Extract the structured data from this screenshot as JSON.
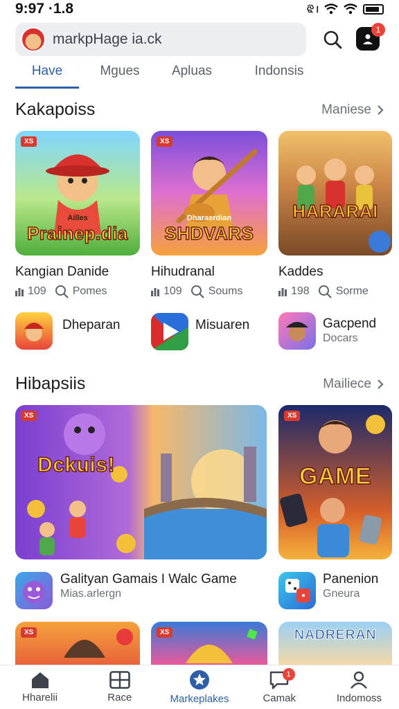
{
  "status": {
    "time": "9:97 ·1.8",
    "signal_text": "ଝି।"
  },
  "search": {
    "text": "markpHage ia.ck"
  },
  "header": {
    "notification_count": "1"
  },
  "tabs": [
    {
      "label": "Have"
    },
    {
      "label": "Mgues"
    },
    {
      "label": "Apluas"
    },
    {
      "label": "Indonsis"
    }
  ],
  "section1": {
    "title": "Kakapoiss",
    "more": "Maniese",
    "cards": [
      {
        "tag": "XS",
        "art_title": "Prainep.dia",
        "art_sub": "Ailles",
        "name": "Kangian Danide",
        "count": "109",
        "meta": "Pomes"
      },
      {
        "tag": "XS",
        "art_title": "SHDVARS",
        "art_sub": "Dharaerdian",
        "name": "Hihudranal",
        "count": "109",
        "meta": "Soums"
      },
      {
        "tag": "",
        "art_title": "HARARAI",
        "art_sub": "",
        "name": "Kaddes",
        "count": "198",
        "meta": "Sorme"
      }
    ],
    "rows": [
      {
        "title": "Dheparan",
        "sub": ""
      },
      {
        "title": "Misuaren",
        "sub": ""
      },
      {
        "title": "Gacpend",
        "sub": "Docars"
      }
    ]
  },
  "section2": {
    "title": "Hibapsiis",
    "more": "Mailiece",
    "cards": [
      {
        "tag": "XS",
        "art_title": "Dckuis!"
      },
      {
        "tag": "XS",
        "art_title": "GAME"
      }
    ],
    "rows": [
      {
        "title": "Galityan Gamais I Walc Game",
        "sub": "Mias.arlergn"
      },
      {
        "title": "Panenion",
        "sub": "Gneura"
      }
    ],
    "peek_cards": [
      {
        "tag": "XS",
        "art_title": ""
      },
      {
        "tag": "XS",
        "art_title": ""
      },
      {
        "tag": "",
        "art_title": "NADRERAN"
      }
    ]
  },
  "nav": [
    {
      "label": "Hharelii",
      "icon": "home-icon"
    },
    {
      "label": "Race",
      "icon": "grid-icon"
    },
    {
      "label": "Markeplakes",
      "icon": "star-icon"
    },
    {
      "label": "Camak",
      "icon": "chat-icon",
      "badge": "1"
    },
    {
      "label": "Indomoss",
      "icon": "person-icon"
    }
  ],
  "colors": {
    "accent": "#2c5fa8",
    "badge": "#e8443a",
    "tag": "#d83a2e"
  }
}
